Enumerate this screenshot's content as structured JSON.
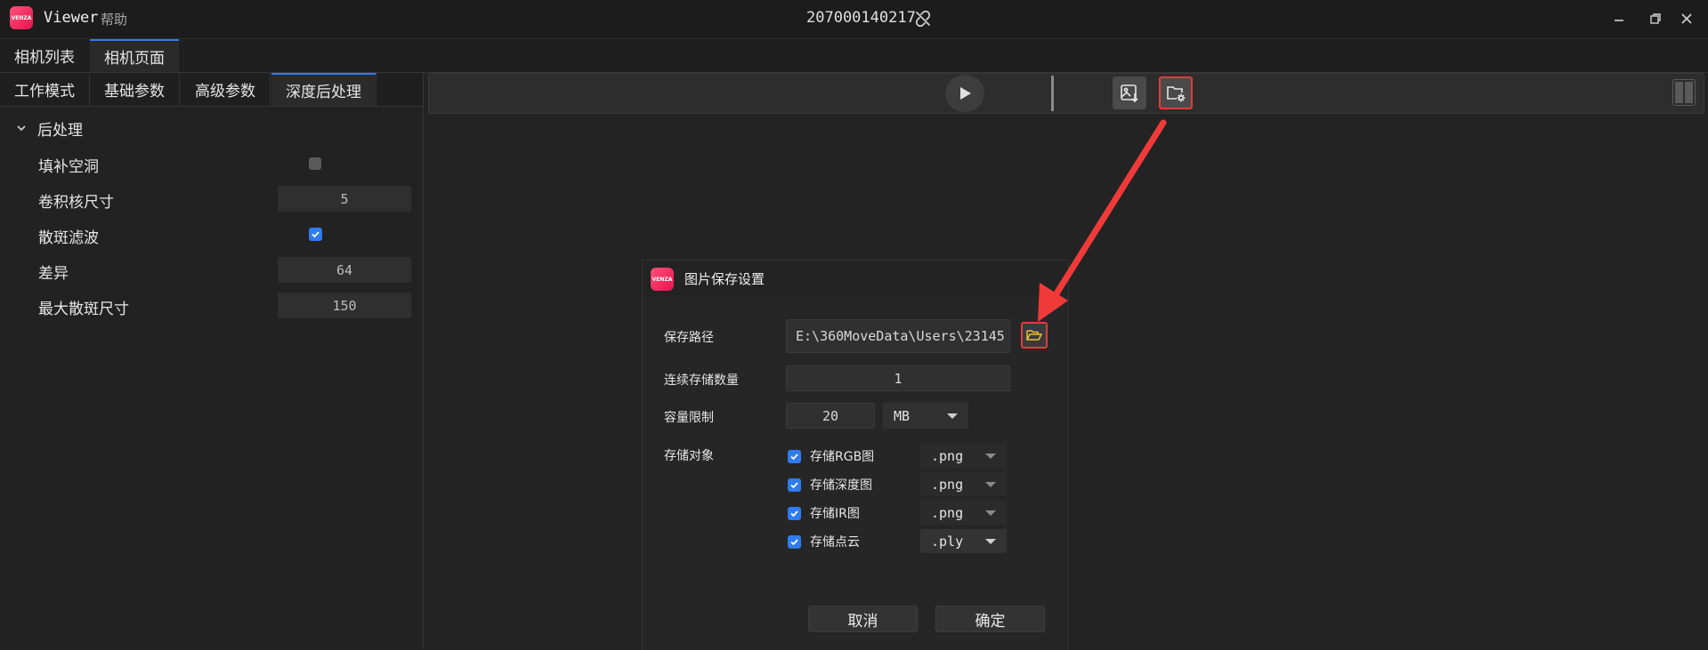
{
  "titlebar": {
    "logo_text": "VENZA",
    "app_name": "Viewer",
    "help_menu": "帮助",
    "serial": "207000140217",
    "link_icon": "link-broken-icon"
  },
  "main_tabs": [
    {
      "label": "相机列表",
      "active": false
    },
    {
      "label": "相机页面",
      "active": true
    }
  ],
  "sub_tabs": [
    {
      "label": "工作模式",
      "active": false
    },
    {
      "label": "基础参数",
      "active": false
    },
    {
      "label": "高级参数",
      "active": false
    },
    {
      "label": "深度后处理",
      "active": true
    }
  ],
  "postprocess": {
    "section_title": "后处理",
    "params": [
      {
        "label": "填补空洞",
        "type": "checkbox",
        "checked": false
      },
      {
        "label": "卷积核尺寸",
        "type": "number",
        "value": "5"
      },
      {
        "label": "散斑滤波",
        "type": "checkbox",
        "checked": true
      },
      {
        "label": "差异",
        "type": "number",
        "value": "64"
      },
      {
        "label": "最大散斑尺寸",
        "type": "number",
        "value": "150"
      }
    ]
  },
  "toolbar": {
    "icons": [
      "play-icon",
      "image-save-icon",
      "folder-settings-icon",
      "split-view-icon"
    ]
  },
  "dialog": {
    "logo_text": "VENZA",
    "title": "图片保存设置",
    "path_label": "保存路径",
    "path_value": "E:\\360MoveData\\Users\\23145",
    "count_label": "连续存储数量",
    "count_value": "1",
    "capacity_label": "容量限制",
    "capacity_value": "20",
    "capacity_unit": "MB",
    "targets_label": "存储对象",
    "targets": [
      {
        "label": "存储RGB图",
        "checked": true,
        "format": ".png"
      },
      {
        "label": "存储深度图",
        "checked": true,
        "format": ".png"
      },
      {
        "label": "存储IR图",
        "checked": true,
        "format": ".png"
      },
      {
        "label": "存储点云",
        "checked": true,
        "format": ".ply"
      }
    ],
    "cancel_label": "取消",
    "ok_label": "确定"
  },
  "colors": {
    "accent": "#2f7cf0",
    "highlight": "#e63a3a",
    "brand": "#ff2d6f"
  }
}
